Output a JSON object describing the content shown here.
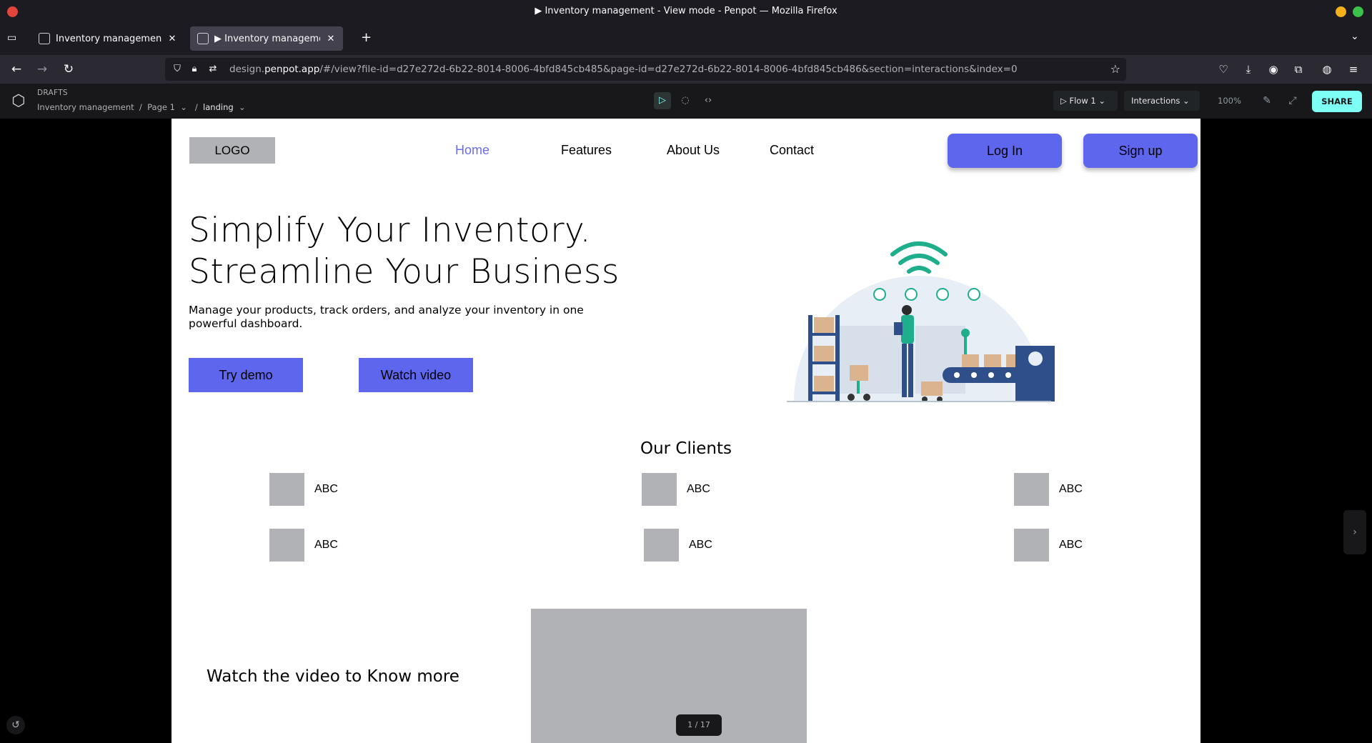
{
  "window": {
    "title": "▶ Inventory management - View mode - Penpot — Mozilla Firefox"
  },
  "browser": {
    "tabs": [
      {
        "label": "Inventory management - Pe",
        "active": false
      },
      {
        "label": "▶ Inventory management - V",
        "active": true
      }
    ],
    "url_prefix": "design.",
    "url_domain": "penpot.app",
    "url_rest": "/#/view?file-id=d27e272d-6b22-8014-8006-4bfd845cb485&page-id=d27e272d-6b22-8014-8006-4bfd845cb486&section=interactions&index=0"
  },
  "penpot": {
    "project": "DRAFTS",
    "file": "Inventory management",
    "page": "Page 1",
    "board": "landing",
    "flow": "Flow 1",
    "section": "Interactions",
    "zoom": "100%",
    "share_label": "SHARE",
    "page_counter": "1 / 17"
  },
  "design": {
    "logo": "LOGO",
    "nav": [
      "Home",
      "Features",
      "About Us",
      "Contact"
    ],
    "login": "Log In",
    "signup": "Sign up",
    "hero_line1": "Simplify Your Inventory.",
    "hero_line2": "Streamline Your Business",
    "hero_sub": "Manage your products, track orders, and analyze your inventory in one powerful dashboard.",
    "try_demo": "Try demo",
    "watch_video": "Watch video",
    "clients_title": "Our Clients",
    "clients": [
      "ABC",
      "ABC",
      "ABC",
      "ABC",
      "ABC",
      "ABC"
    ],
    "video_text": "Watch the video to Know more"
  },
  "colors": {
    "accent": "#5e66ee",
    "active_link": "#6b6bf0",
    "placeholder_gray": "#b1b2b5",
    "penpot_share": "#7efff5",
    "illustration_teal": "#1fae8c"
  }
}
